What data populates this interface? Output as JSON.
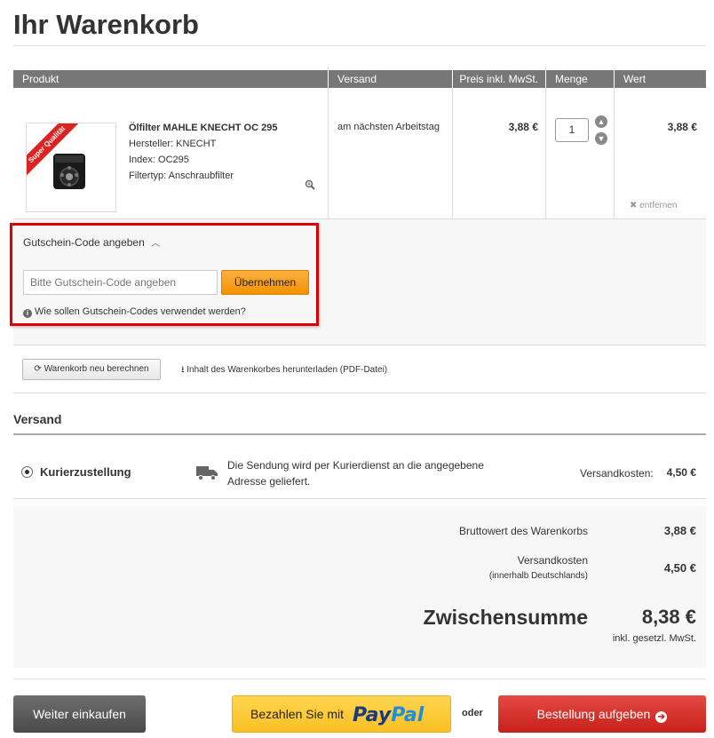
{
  "page_title": "Ihr Warenkorb",
  "table": {
    "headers": [
      "Produkt",
      "Versand",
      "Preis inkl. MwSt.",
      "Menge",
      "Wert"
    ],
    "item": {
      "badge": "Super Qualität",
      "name": "Ölfilter MAHLE KNECHT OC 295",
      "manufacturer": "Hersteller: KNECHT",
      "index": "Index: OC295",
      "filter_type": "Filtertyp: Anschraubfilter",
      "shipping": "am nächsten Arbeitstag",
      "price": "3,88 €",
      "quantity": "1",
      "value": "3,88 €",
      "remove": "entfernen"
    }
  },
  "coupon": {
    "title": "Gutschein-Code angeben",
    "placeholder": "Bitte Gutschein-Code angeben",
    "apply": "Übernehmen",
    "help": "Wie sollen Gutschein-Codes verwendet werden?"
  },
  "actions": {
    "recalculate": "Warenkorb neu berechnen",
    "download_pdf": "Inhalt des Warenkorbes herunterladen (PDF-Datei)"
  },
  "shipping": {
    "section_title": "Versand",
    "method": "Kurierzustellung",
    "description": "Die Sendung wird per Kurierdienst an die angegebene Adresse geliefert.",
    "cost_label": "Versandkosten:",
    "cost": "4,50 €"
  },
  "totals": {
    "gross_label": "Bruttowert des Warenkorbs",
    "gross": "3,88 €",
    "shipping_label": "Versandkosten",
    "shipping_sub": "(innerhalb Deutschlands)",
    "shipping": "4,50 €",
    "subtotal_label": "Zwischensumme",
    "subtotal": "8,38 €",
    "vat_note": "inkl. gesetzl. MwSt."
  },
  "footer": {
    "continue": "Weiter einkaufen",
    "paypal_prefix": "Bezahlen Sie mit",
    "paypal_pay": "Pay",
    "paypal_pal": "Pal",
    "or": "oder",
    "order": "Bestellung aufgeben"
  },
  "colors": {
    "header_bg": "#777777",
    "highlight_border": "#dd0000",
    "apply_button": "#f39200",
    "order_button": "#c8201a",
    "paypal_button": "#f9c024"
  }
}
